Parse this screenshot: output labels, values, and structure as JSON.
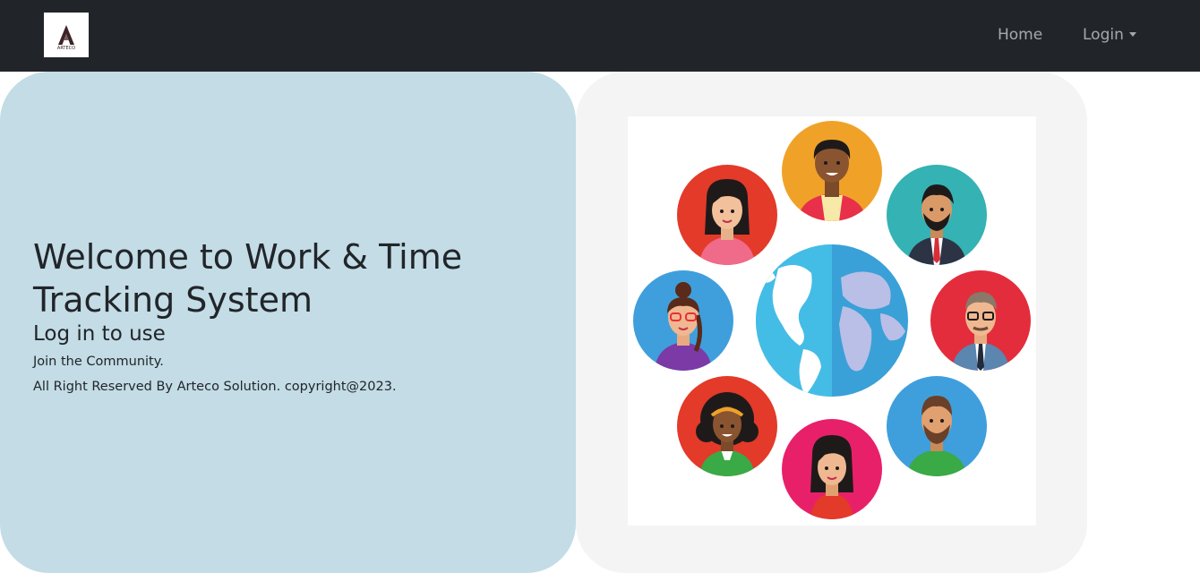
{
  "brand": {
    "logo_text": "ARTECO",
    "logo_icon": "arteco-logo"
  },
  "nav": {
    "home_label": "Home",
    "login_label": "Login",
    "login_icon": "caret-down-icon"
  },
  "hero": {
    "title": "Welcome to Work & Time Tracking System",
    "subtitle": "Log in to use",
    "tagline": "Join the Community.",
    "copyright": "All Right Reserved By Arteco Solution. copyright@2023."
  },
  "illustration": {
    "name": "global-community-avatars"
  },
  "colors": {
    "navbar_bg": "#212529",
    "nav_text": "#9a9da0",
    "left_panel_bg": "#c3dce6",
    "right_panel_bg": "#f4f4f4",
    "text_dark": "#212529"
  }
}
